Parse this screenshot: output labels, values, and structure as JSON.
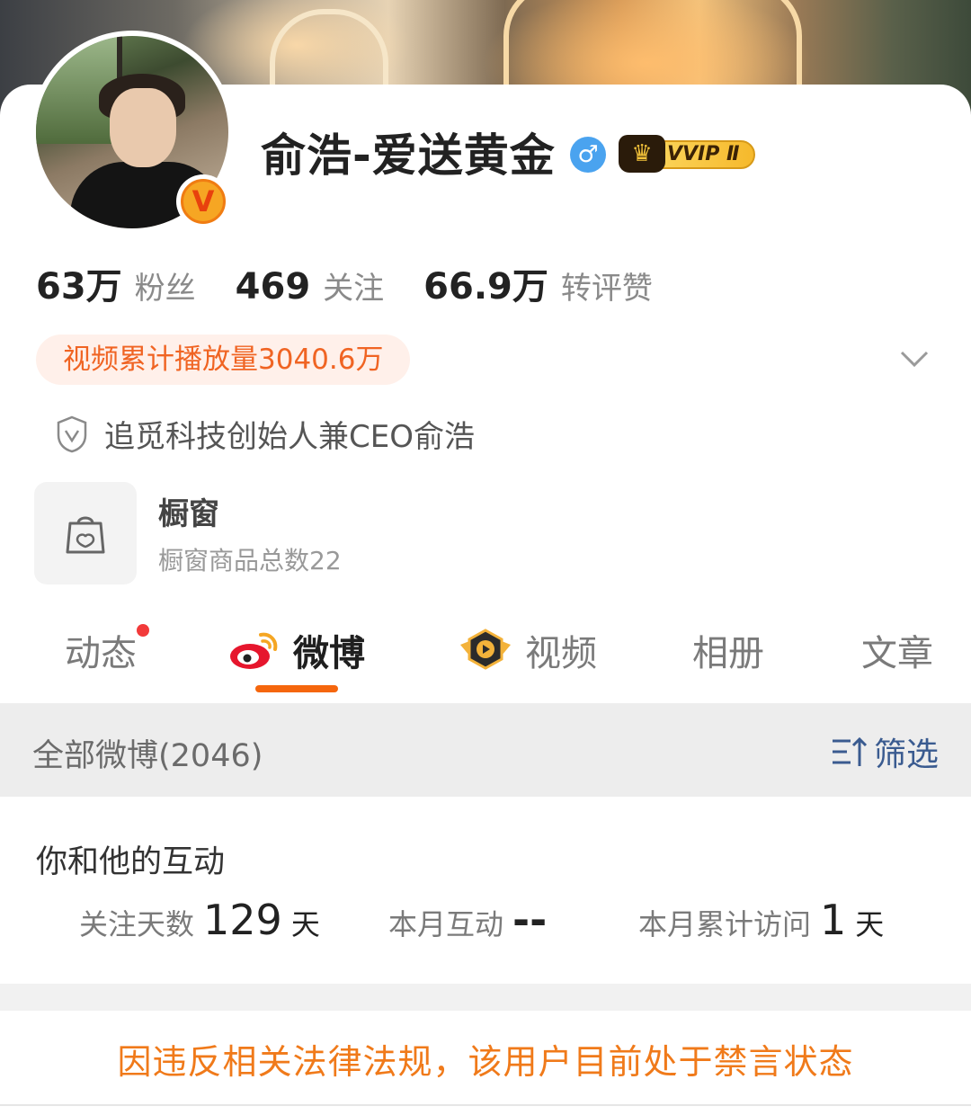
{
  "profile": {
    "name": "俞浩-爱送黄金",
    "gender_symbol": "♂",
    "vip_label": "VVIP Ⅱ",
    "verified_badge": "V"
  },
  "stats": [
    {
      "value": "63万",
      "label": "粉丝"
    },
    {
      "value": "469",
      "label": "关注"
    },
    {
      "value": "66.9万",
      "label": "转评赞"
    }
  ],
  "video_pill": "视频累计播放量3040.6万",
  "verification": "追觅科技创始人兼CEO俞浩",
  "shop": {
    "title": "橱窗",
    "subtitle": "橱窗商品总数22"
  },
  "tabs": [
    {
      "label": "动态"
    },
    {
      "label": "微博"
    },
    {
      "label": "视频"
    },
    {
      "label": "相册"
    },
    {
      "label": "文章"
    }
  ],
  "filter_bar": {
    "all_label": "全部微博(2046)",
    "filter_label": "筛选"
  },
  "interaction": {
    "title": "你和他的互动",
    "follow_days": {
      "label": "关注天数",
      "value": "129",
      "unit": "天"
    },
    "month_interaction": {
      "label": "本月互动",
      "value": "--"
    },
    "month_visits": {
      "label": "本月累计访问",
      "value": "1",
      "unit": "天"
    }
  },
  "ban_notice": "因违反相关法律法规，该用户目前处于禁言状态",
  "colors": {
    "accent": "#f5660d",
    "pill_text": "#f06423",
    "filter_link": "#3a5b90",
    "notice": "#f07a1a"
  }
}
